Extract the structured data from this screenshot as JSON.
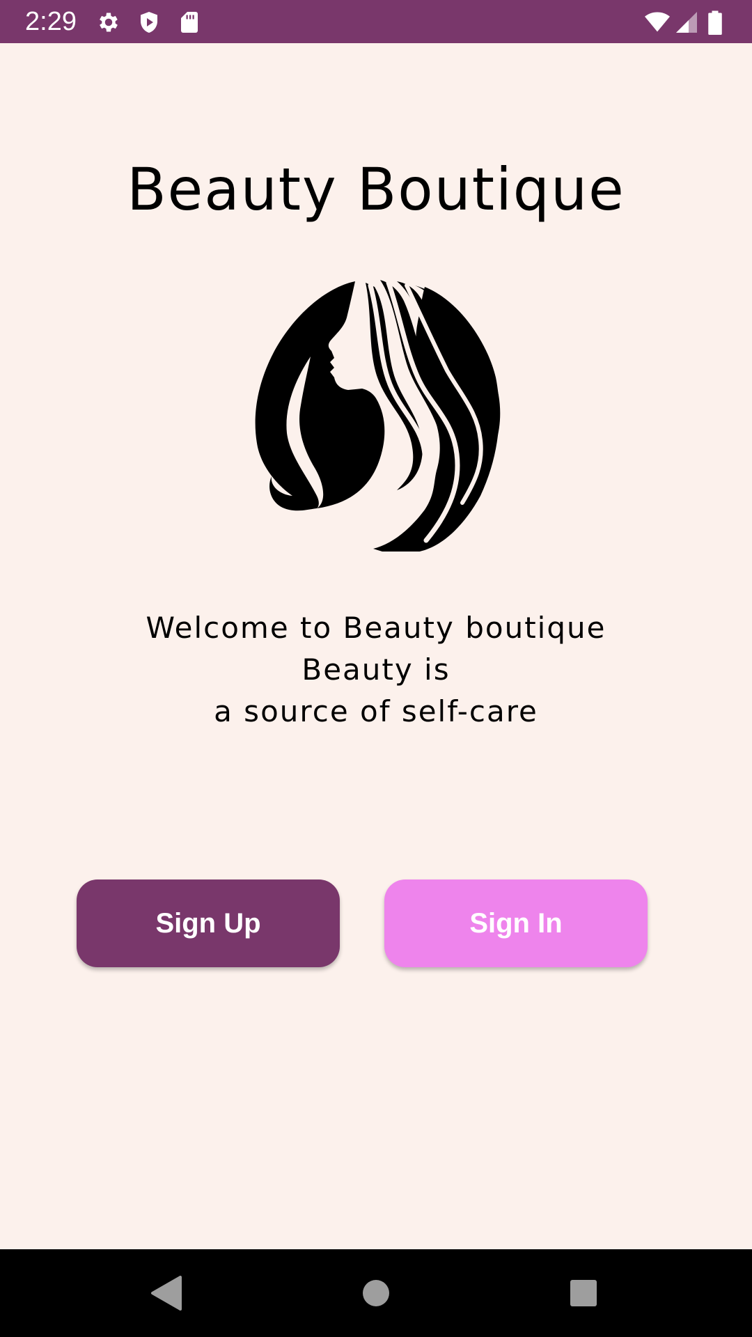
{
  "status_bar": {
    "time": "2:29",
    "icons_left": [
      "gear-icon",
      "shield-play-icon",
      "sd-card-icon"
    ],
    "icons_right": [
      "wifi-icon",
      "cell-signal-icon",
      "battery-icon"
    ],
    "background_color": "#79376b"
  },
  "header": {
    "title": "Beauty Boutique"
  },
  "logo": {
    "icon": "woman-hair-silhouette-logo"
  },
  "welcome": {
    "line1": "Welcome to Beauty boutique Beauty is",
    "line2": "a source of self-care"
  },
  "actions": {
    "signup_label": "Sign Up",
    "signup_color": "#79376b",
    "signin_label": "Sign In",
    "signin_color": "#ee84ec"
  },
  "nav_bar": {
    "back": "back-icon",
    "home": "home-icon",
    "recents": "recents-icon"
  },
  "colors": {
    "background": "#fcf1ec",
    "text": "#000000"
  }
}
